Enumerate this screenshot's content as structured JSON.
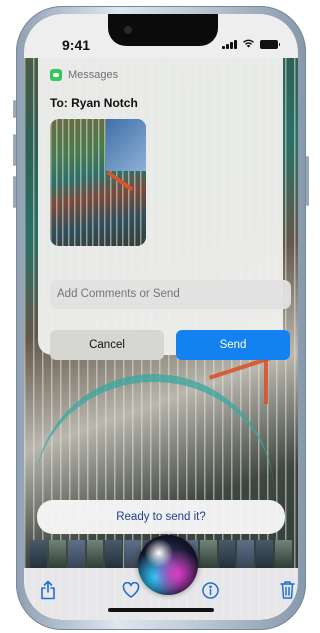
{
  "status_bar": {
    "time": "9:41"
  },
  "intent_card": {
    "app_name": "Messages",
    "app_icon": "messages-app-icon",
    "accent_color": "#34c759",
    "recipient_line": "To: Ryan Notch",
    "attachment": "photo-thumbnail",
    "comment": {
      "placeholder": "Add Comments or Send",
      "value": ""
    },
    "cancel_label": "Cancel",
    "send_label": "Send",
    "send_color": "#1481f0"
  },
  "siri": {
    "response": "Ready to send it?"
  },
  "toolbar": {
    "items": [
      "share-icon",
      "heart-icon",
      "info-icon",
      "trash-icon"
    ],
    "tint": "#1f6fd6"
  }
}
